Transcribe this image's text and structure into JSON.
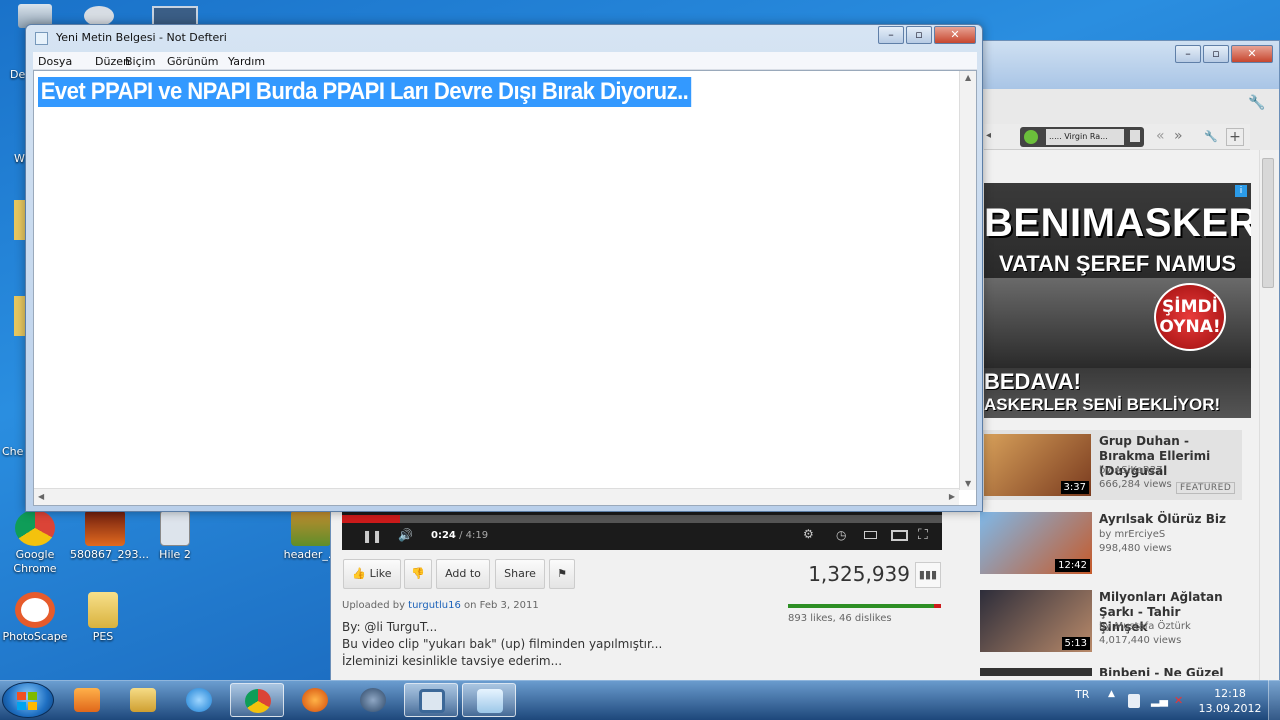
{
  "notepad": {
    "title": "Yeni Metin Belgesi - Not Defteri",
    "menu": [
      "Dosya",
      "Düzen",
      "Biçim",
      "Görünüm",
      "Yardım"
    ],
    "content": "Evet PPAPI ve NPAPI Burda PPAPI Ları Devre Dışı Bırak Diyoruz.."
  },
  "desktop": {
    "icons": [
      {
        "label": "Google Chrome"
      },
      {
        "label": "580867_293..."
      },
      {
        "label": "Hile 2"
      },
      {
        "label": "header_..."
      },
      {
        "label": "PhotoScape"
      },
      {
        "label": "PES"
      },
      {
        "label": "Che"
      },
      {
        "label": "De"
      },
      {
        "label": "W"
      }
    ]
  },
  "browser": {
    "extension": {
      "station": "..... Virgin Ra..."
    },
    "ad": {
      "title": "BENIMASKER",
      "subtitle": "VATAN ŞEREF NAMUS",
      "button": "ŞİMDİ OYNA!",
      "line1": "BEDAVA!",
      "line2": "ASKERLER SENİ BEKLİYOR!"
    },
    "related": [
      {
        "title": "Grup Duhan - Bırakma Ellerimi (Duygusal",
        "by": "ASiKaR27",
        "views": "666,284 views",
        "duration": "3:37",
        "badge": "FEATURED"
      },
      {
        "title": "Ayrılsak Ölürüz Biz",
        "by": "mrErciyeS",
        "views": "998,480 views",
        "duration": "12:42"
      },
      {
        "title": "Milyonları Ağlatan Şarkı - Tahir Şimşek",
        "by": "Mustafa Öztürk",
        "views": "4,017,440 views",
        "duration": "5:13"
      },
      {
        "title": "Binbeni - Ne Güzel"
      }
    ],
    "player": {
      "current_time": "0:24",
      "total_time": "/ 4:19",
      "progress": 0.096
    },
    "actions": {
      "like": "Like",
      "add_to": "Add to",
      "share": "Share"
    },
    "view_count": "1,325,939",
    "likes_text": "893 likes, 46 dislikes",
    "like_ratio": 0.951,
    "uploaded": {
      "prefix": "Uploaded by",
      "user": "turgutlu16",
      "date": "on Feb 3, 2011"
    },
    "description": [
      "By: @li TurguT...",
      "Bu video clip \"yukarı bak\" (up) filminden yapılmıştır...",
      "İzleminizi kesinlikle tavsiye ederim..."
    ]
  },
  "taskbar": {
    "language": "TR",
    "time": "12:18",
    "date": "13.09.2012"
  },
  "colors": {
    "selection": "#3399ff",
    "progress": "#cc1b1b",
    "likes": "#2d8f24",
    "link": "#1c62b9"
  }
}
